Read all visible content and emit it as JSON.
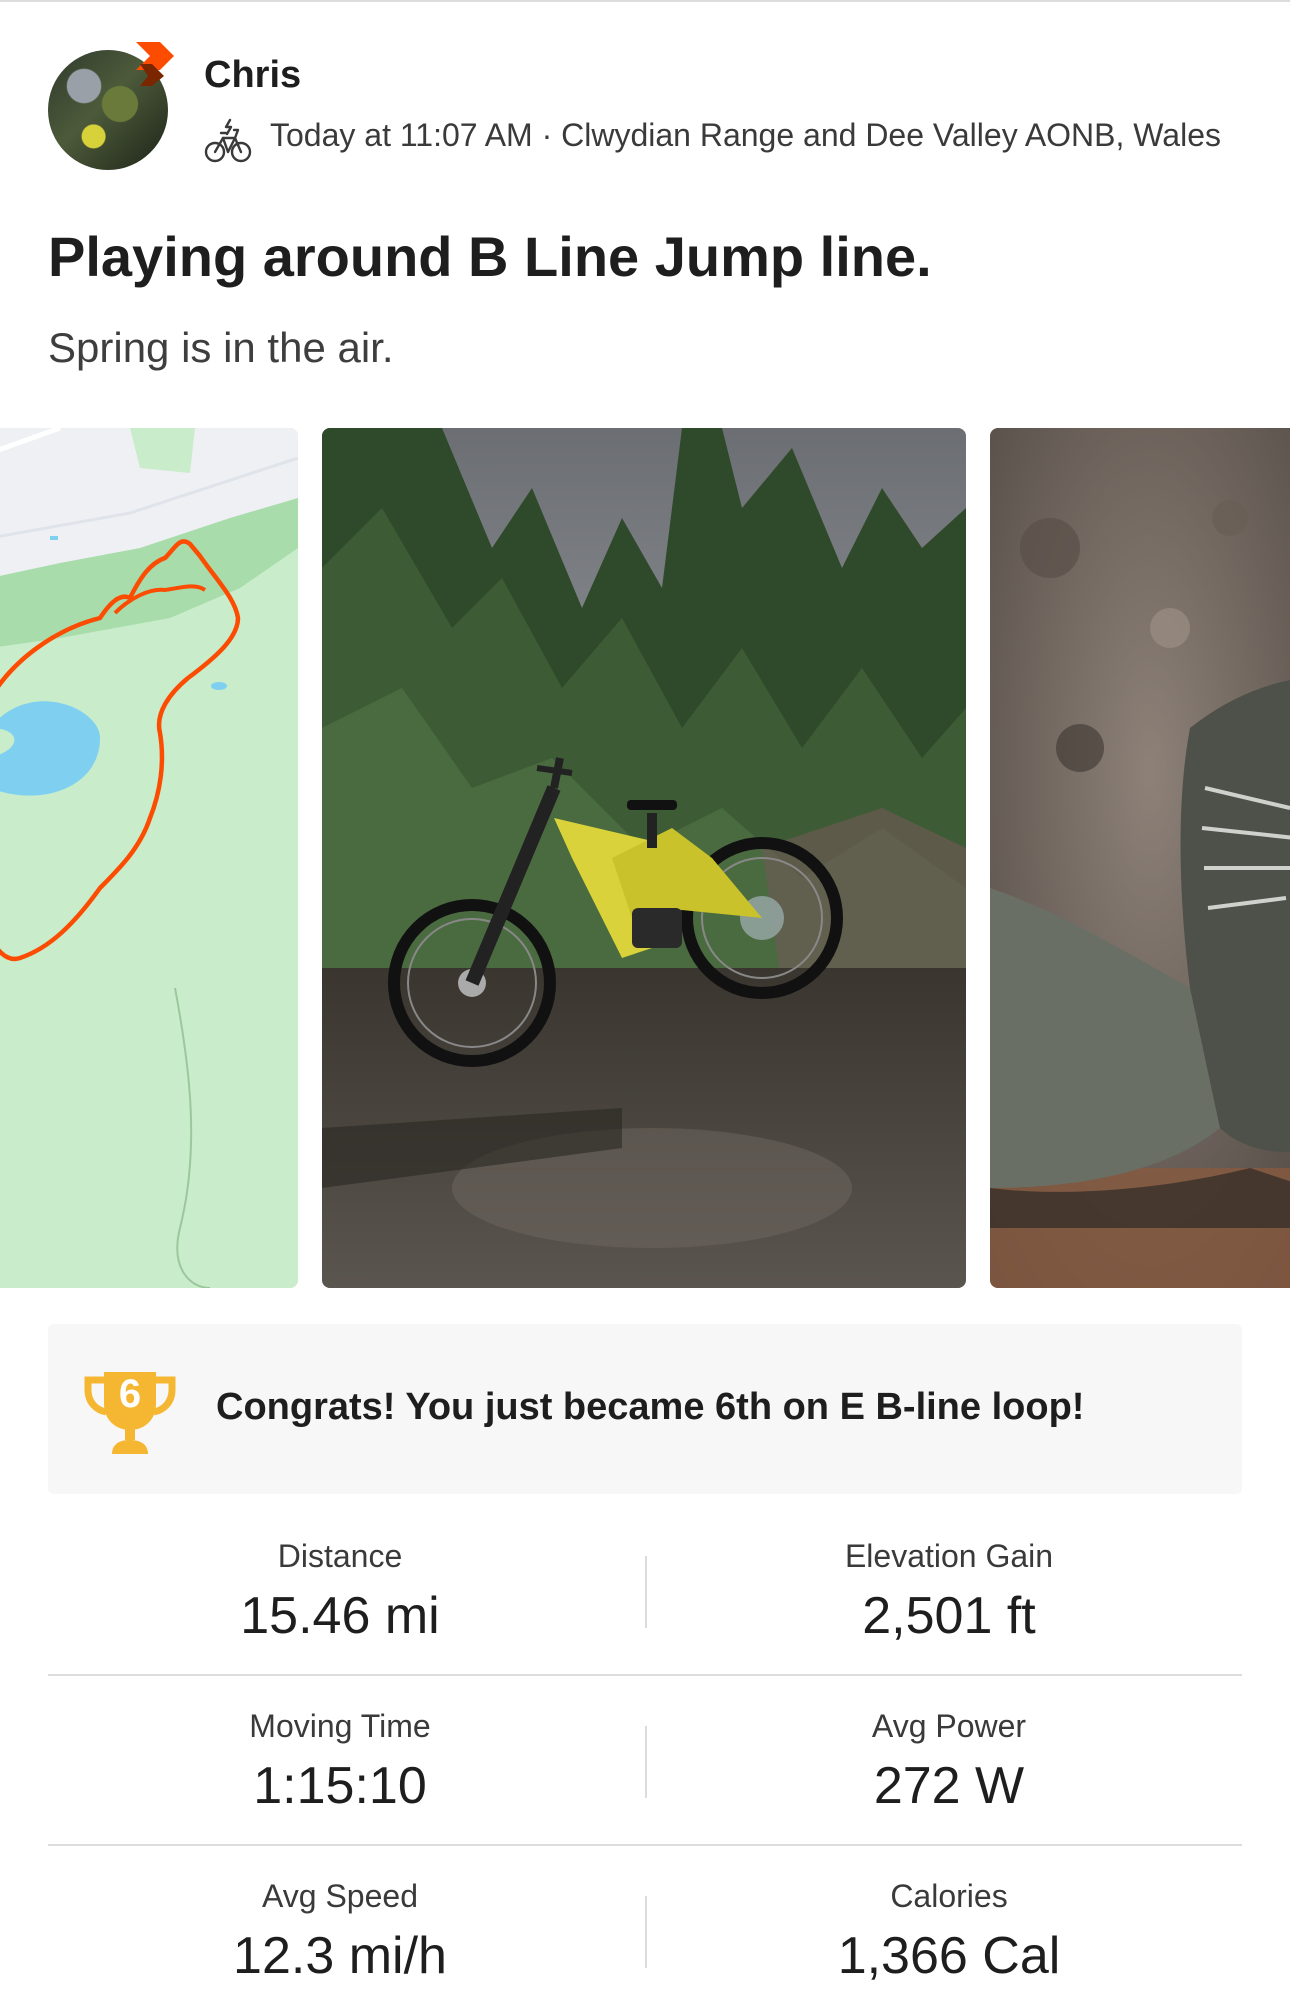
{
  "activity": {
    "athlete_name": "Chris",
    "timestamp": "Today at 11:07 AM",
    "location": "Clwydian Range and Dee Valley AONB, Wales",
    "title": "Playing around B Line Jump line.",
    "description": "Spring is in the air.",
    "activity_type_icon": "e-bike-icon",
    "accent_color": "#fc4c02"
  },
  "media": [
    "route-map",
    "bike-photo",
    "shoe-photo"
  ],
  "achievement": {
    "icon": "trophy-icon",
    "rank": "6",
    "text": "Congrats! You just became 6th on E B-line loop!",
    "trophy_color": "#f5b731"
  },
  "stats": [
    {
      "label": "Distance",
      "value": "15.46 mi"
    },
    {
      "label": "Elevation Gain",
      "value": "2,501 ft"
    },
    {
      "label": "Moving Time",
      "value": "1:15:10"
    },
    {
      "label": "Avg Power",
      "value": "272 W"
    },
    {
      "label": "Avg Speed",
      "value": "12.3 mi/h"
    },
    {
      "label": "Calories",
      "value": "1,366 Cal"
    }
  ]
}
